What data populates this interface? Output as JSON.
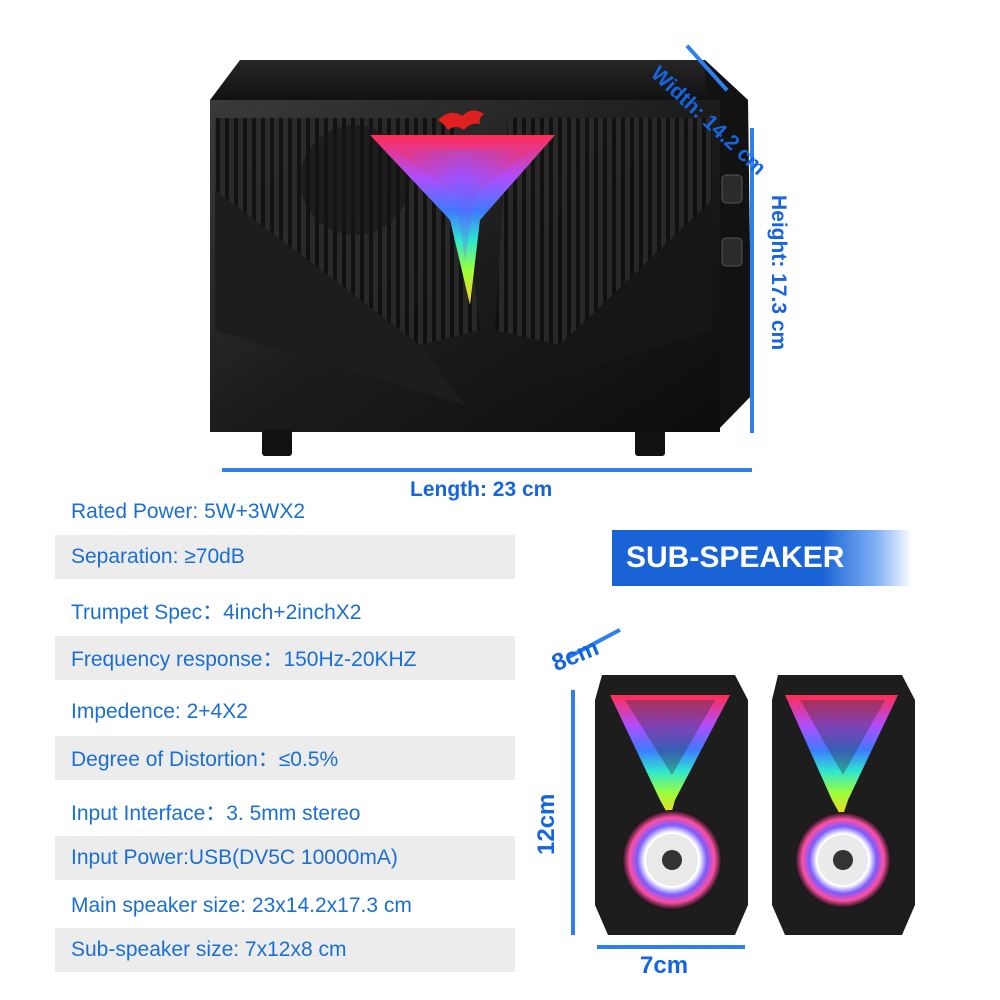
{
  "dimensions": {
    "width": "Width: 14.2 cm",
    "height": "Height: 17.3 cm",
    "length": "Length: 23 cm"
  },
  "specs": [
    "Rated Power: 5W+3WX2",
    "Separation:  ≥70dB",
    "Trumpet Spec：4inch+2inchX2",
    "Frequency response：150Hz-20KHZ",
    "Impedence: 2+4X2",
    "Degree of Distortion：≤0.5%",
    "Input Interface：3. 5mm stereo",
    "Input Power:USB(DV5C 10000mA)",
    "Main speaker size: 23x14.2x17.3 cm",
    "Sub-speaker size: 7x12x8 cm"
  ],
  "sub_speaker": {
    "title": "SUB-SPEAKER",
    "depth": "8cm",
    "height": "12cm",
    "width": "7cm"
  },
  "colors": {
    "accent_blue": "#1565e0",
    "spec_text": "#1a6fd6",
    "row_shade": "#ececec"
  }
}
